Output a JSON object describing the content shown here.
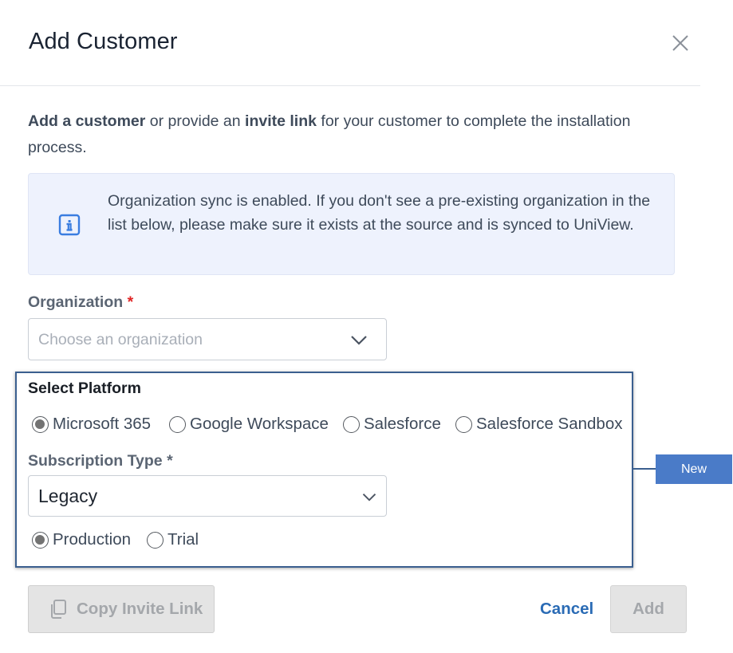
{
  "dialog": {
    "title": "Add Customer"
  },
  "intro": {
    "part1": "Add a customer",
    "part2": " or provide an ",
    "part3": "invite link",
    "part4": " for your customer to complete the installation process."
  },
  "info": {
    "icon": "info-icon",
    "text": "Organization sync is enabled. If you don't see a pre-existing organization in the list below, please make sure it exists at the source and is synced to UniView."
  },
  "organization": {
    "label": "Organization",
    "required_mark": "*",
    "placeholder": "Choose an organization"
  },
  "platform": {
    "label": "Select Platform",
    "options": [
      {
        "label": "Microsoft 365",
        "checked": true
      },
      {
        "label": "Google Workspace",
        "checked": false
      },
      {
        "label": "Salesforce",
        "checked": false
      },
      {
        "label": "Salesforce Sandbox",
        "checked": false
      }
    ]
  },
  "subscription": {
    "label": "Subscription Type *",
    "value": "Legacy",
    "environments": [
      {
        "label": "Production",
        "checked": true
      },
      {
        "label": "Trial",
        "checked": false
      }
    ]
  },
  "callout": {
    "label": "New"
  },
  "footer": {
    "copy_label": "Copy Invite Link",
    "cancel_label": "Cancel",
    "add_label": "Add"
  },
  "colors": {
    "accent": "#2a6bb5",
    "info_bg": "#eef2fd",
    "highlight_border": "#3b5f8f",
    "callout_bg": "#4a7bc8",
    "required": "#e02424"
  }
}
